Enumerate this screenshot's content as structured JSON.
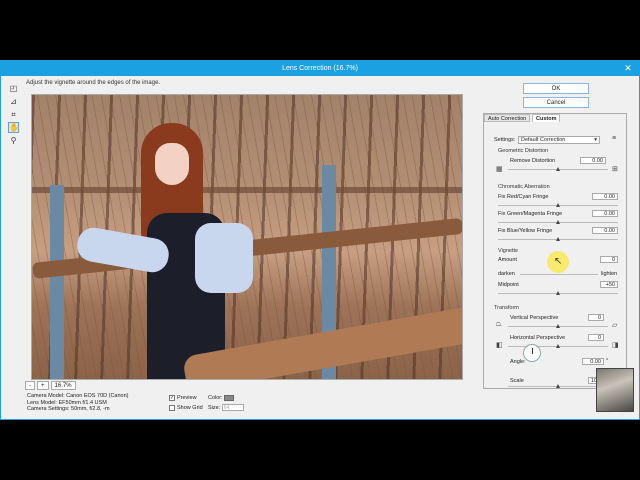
{
  "window": {
    "title": "Lens Correction (16.7%)",
    "close_icon": "close-icon"
  },
  "hint": "Adjust the vignette around the edges of the image.",
  "tools": [
    "remove-distortion-tool-icon",
    "straighten-tool-icon",
    "move-grid-tool-icon",
    "hand-tool-icon",
    "zoom-tool-icon"
  ],
  "zoom": {
    "minus": "-",
    "plus": "+",
    "value": "16.7%"
  },
  "camera_info": {
    "model": "Camera Model: Canon EOS 70D (Canon)",
    "lens": "Lens Model: EF50mm f/1.4 USM",
    "settings": "Camera Settings: 50mm, f/2.8, -m"
  },
  "preview_opts": {
    "preview": "Preview",
    "show_grid": "Show Grid",
    "color": "Color:",
    "size": "Size:",
    "size_value": "64"
  },
  "buttons": {
    "ok": "OK",
    "cancel": "Cancel"
  },
  "tabs": {
    "auto": "Auto Correction",
    "custom": "Custom"
  },
  "settings": {
    "label": "Settings:",
    "value": "Default Correction",
    "menu_icon": "panel-menu-icon"
  },
  "geometric": {
    "title": "Geometric Distortion",
    "remove_label": "Remove Distortion",
    "remove_value": "0.00"
  },
  "chromatic": {
    "title": "Chromatic Aberration",
    "red_cyan": "Fix Red/Cyan Fringe",
    "red_cyan_value": "0.00",
    "green_magenta": "Fix Green/Magenta Fringe",
    "green_magenta_value": "0.00",
    "blue_yellow": "Fix Blue/Yellow Fringe",
    "blue_yellow_value": "0.00"
  },
  "vignette": {
    "title": "Vignette",
    "amount": "Amount",
    "amount_value": "0",
    "darken": "darken",
    "lighten": "lighten",
    "midpoint": "Midpoint",
    "midpoint_value": "+50"
  },
  "transform": {
    "title": "Transform",
    "vertical": "Vertical Perspective",
    "vertical_value": "0",
    "horizontal": "Horizontal Perspective",
    "horizontal_value": "0",
    "angle": "Angle:",
    "angle_value": "0.00",
    "degree": "°",
    "scale": "Scale",
    "scale_value": "100%"
  }
}
